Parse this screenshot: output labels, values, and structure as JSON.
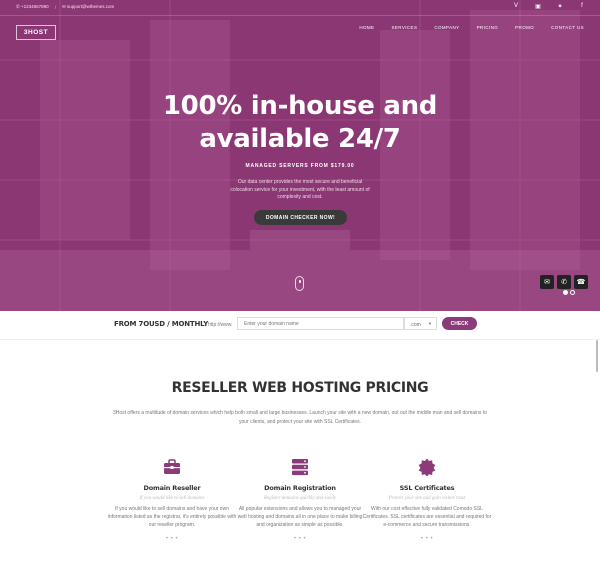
{
  "topbar": {
    "phone": "✆ +1234567890",
    "separator": "/",
    "email": "✉ support@wthemes.com",
    "social": [
      "vimeo-icon",
      "foursquare-icon",
      "twitter-icon",
      "facebook-icon"
    ],
    "social_glyphs": [
      "V",
      "▣",
      "✦",
      "f"
    ]
  },
  "header": {
    "logo": "3HOST",
    "nav": [
      "HOME",
      "SERVICES",
      "COMPANY",
      "PRICING",
      "PROMO",
      "CONTACT US"
    ]
  },
  "hero": {
    "title_line1": "100% in-house and",
    "title_line2": "available 24/7",
    "subtitle": "MANAGED SERVERS FROM $179.00",
    "description": "Our data center provides the most secure and beneficial colocation service for your investment, with the least amount of complexity and cost.",
    "cta": "DOMAIN CHECKER NOW!",
    "quick_glyphs": [
      "✉",
      "✆",
      "☎"
    ],
    "slides": 2,
    "active_slide": 1
  },
  "domain_bar": {
    "price": "FROM 7OUSD / MONTHLY",
    "prefix": "http://www.",
    "placeholder": "Enter your domain name",
    "tld": ".com",
    "tld_caret": "▼",
    "button": "CHECK"
  },
  "pricing": {
    "title": "RESELLER WEB HOSTING PRICING",
    "description": "3Host offers a multitude of domain services which help both small and large businesses. Launch your site with a new domain, out out the middle man and sell domains to your clients, and protect your site with SSL Certificates.",
    "features": [
      {
        "icon": "briefcase-icon",
        "title": "Domain Reseller",
        "tagline": "If you would like to sell domains",
        "description": "If you would like to sell domains and have your own information listed as the registrar, it's entirely possible with our reseller program.",
        "more": "• • •"
      },
      {
        "icon": "server-icon",
        "title": "Domain Registration",
        "tagline": "Register domains quickly and easily",
        "description": "All popular extensions and allows you to managed your web hosting and domains all in one place to make billing and organization as simple as possible.",
        "more": "• • •"
      },
      {
        "icon": "certificate-icon",
        "title": "SSL Certificates",
        "tagline": "Protect your site and gain visitor trust",
        "description": "With our cost effective fully validated Comodo SSL Certificates. SSL certificates are essential and required for e-commerce and secure transmissions.",
        "more": "• • •"
      }
    ]
  },
  "colors": {
    "brand": "#8b3a7a",
    "hero_overlay": "#963478",
    "dark_button": "#3a3a3a"
  }
}
